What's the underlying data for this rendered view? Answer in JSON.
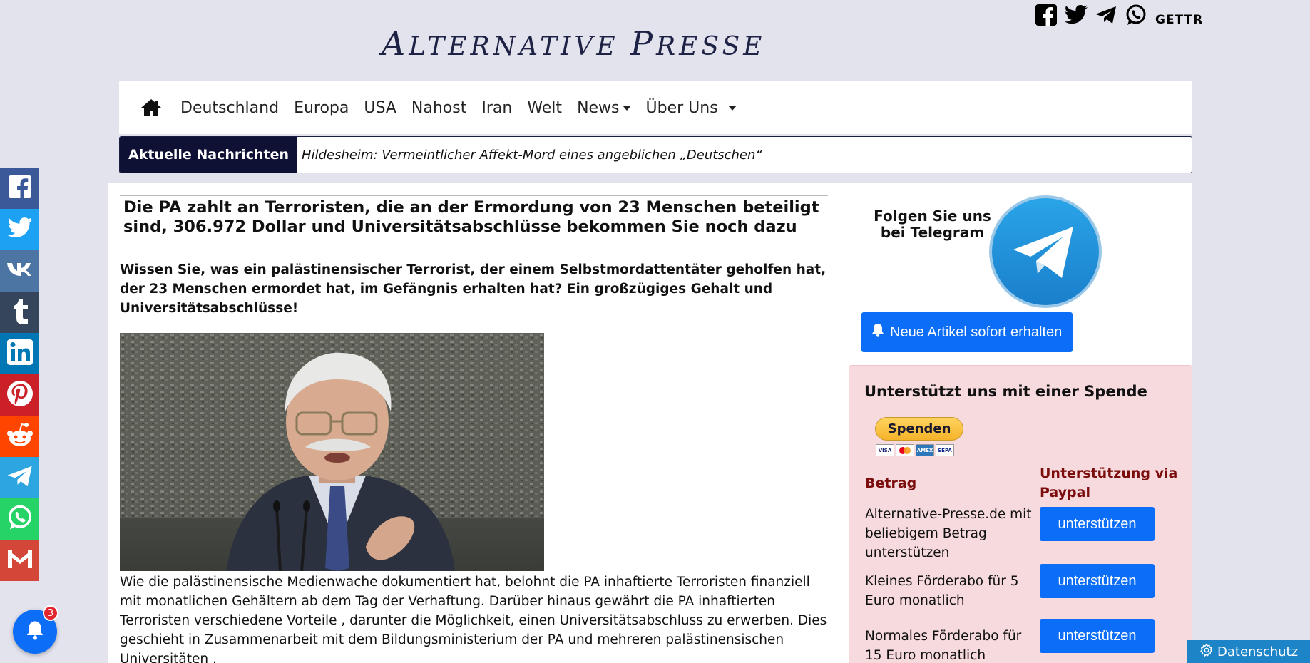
{
  "brand": {
    "logo_initial_1": "A",
    "logo_rest_1": "LTERNATIVE ",
    "logo_initial_2": "P",
    "logo_rest_2": "RESSE",
    "gettr": "GETTR"
  },
  "top_social": [
    "facebook-square-icon",
    "twitter-icon",
    "telegram-icon",
    "whatsapp-icon"
  ],
  "nav": {
    "home_icon": "home-icon",
    "items": [
      "Deutschland",
      "Europa",
      "USA",
      "Nahost",
      "Iran",
      "Welt",
      "News",
      "Über Uns"
    ]
  },
  "ticker": {
    "label": "Aktuelle Nachrichten",
    "headline": "Hildesheim: Vermeintlicher Affekt-Mord eines angeblichen „Deutschen“"
  },
  "article": {
    "title": "Die PA zahlt an Terroristen, die an der Ermordung von 23 Menschen beteiligt sind, 306.972 Dollar und Universitätsabschlüsse bekommen Sie noch dazu",
    "lead": "Wissen Sie, was ein palästinensischer Terrorist, der einem Selbstmordattentäter geholfen hat, der 23 Menschen ermordet hat, im Gefängnis erhalten hat? Ein großzügiges Gehalt und Universitätsabschlüsse!",
    "body": "Wie  die palästinensische Medienwache  dokumentiert hat, belohnt die PA inhaftierte Terroristen finanziell mit monatlichen  Gehältern  ab dem Tag der Verhaftung. Darüber hinaus gewährt die PA inhaftierten Terroristen  verschiedene Vorteile , darunter die Möglichkeit, einen Universitätsabschluss zu erwerben. Dies geschieht in Zusammenarbeit mit dem  Bildungsministerium der PA  und  mehreren palästinensischen Universitäten ."
  },
  "sidebar": {
    "telegram_promo": "Folgen Sie uns bei Telegram",
    "notify_button": "Neue Artikel sofort erhalten",
    "donate": {
      "title": "Unterstützt uns mit einer Spende",
      "paypal_button": "Spenden",
      "cards": [
        "VISA",
        "MC",
        "AMEX",
        "SEPA"
      ],
      "col_amount": "Betrag",
      "col_paypal": "Unterstützung via Paypal",
      "rows": [
        {
          "text": "Alternative-Presse.de mit beliebigem Betrag unterstützen",
          "button": "unterstützen"
        },
        {
          "text": "Kleines Förderabo für 5 Euro monatlich",
          "button": "unterstützen"
        },
        {
          "text": "Normales Förderabo für 15 Euro monatlich",
          "button": "unterstützen"
        }
      ]
    }
  },
  "share_bar": [
    {
      "icon": "facebook-icon",
      "color": "#3b5998"
    },
    {
      "icon": "twitter-icon",
      "color": "#1da1f2"
    },
    {
      "icon": "vk-icon",
      "color": "#4c75a3"
    },
    {
      "icon": "tumblr-icon",
      "color": "#35465c"
    },
    {
      "icon": "linkedin-icon",
      "color": "#0077b5"
    },
    {
      "icon": "pinterest-icon",
      "color": "#cb2027"
    },
    {
      "icon": "reddit-icon",
      "color": "#ff4500"
    },
    {
      "icon": "telegram-icon",
      "color": "#2ca5e0"
    },
    {
      "icon": "whatsapp-icon",
      "color": "#25d366"
    },
    {
      "icon": "gmail-icon",
      "color": "#d44638"
    }
  ],
  "notification_bell": {
    "badge": "3"
  },
  "privacy_button": "Datenschutz"
}
